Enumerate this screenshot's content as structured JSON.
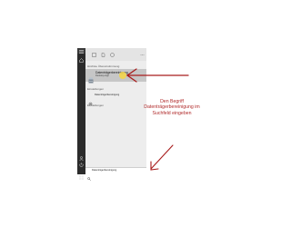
{
  "start_menu": {
    "best_match_header": "Höchste Übereinstimmung",
    "best_match": {
      "title": "Datenträgerbereinigung",
      "subtitle": "Desktop-App"
    },
    "settings_header": "Einstellungen",
    "settings_item": "Datenträgerbereinigung",
    "web_header": "Einstellungen"
  },
  "taskbar": {
    "search_value": "Datenträgerbereinigung"
  },
  "annotation": {
    "text": "Den Begriff Datenträgerbereinigung im Suchfeld eingeben"
  },
  "colors": {
    "arrow": "#a81c1c",
    "rail": "#2b2b2b",
    "highlight": "#c6c6c6",
    "cursor": "#f2d54a"
  },
  "icons": [
    "hamburger-icon",
    "home-icon",
    "document-icon",
    "gear-icon",
    "lightning-icon",
    "disk-cleanup-icon",
    "settings-app-icon",
    "search-icon",
    "windows-logo-icon",
    "user-icon",
    "power-icon"
  ]
}
